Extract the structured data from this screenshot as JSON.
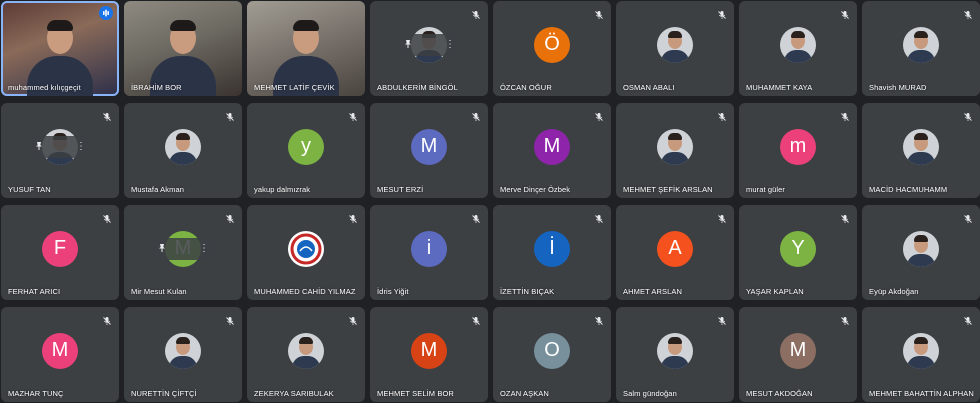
{
  "meeting": {
    "participants": [
      {
        "name": "muhammed kılıçgeçit",
        "type": "video",
        "video": "video-1",
        "speaking": true
      },
      {
        "name": "İBRAHİM BOR",
        "type": "video",
        "video": "video-2"
      },
      {
        "name": "MEHMET LATİF ÇEVİK",
        "type": "video",
        "video": "video-3"
      },
      {
        "name": "ABDULKERİM BİNGÖL",
        "type": "photo-pinmenu",
        "muted": true
      },
      {
        "name": "ÖZCAN OĞUR",
        "type": "letter",
        "letter": "Ö",
        "color": "#e8710a",
        "muted": true
      },
      {
        "name": "OSMAN ABALI",
        "type": "photo",
        "muted": true
      },
      {
        "name": "MUHAMMET KAYA",
        "type": "photo",
        "muted": true
      },
      {
        "name": "Shavish MURAD",
        "type": "photo",
        "muted": true
      },
      {
        "name": "YUSUF TAN",
        "type": "photo-pinmenu",
        "muted": true
      },
      {
        "name": "Mustafa Akman",
        "type": "photo",
        "muted": true
      },
      {
        "name": "yakup dalmızrak",
        "type": "letter",
        "letter": "y",
        "color": "#7cb342",
        "muted": true
      },
      {
        "name": "MESUT ERZİ",
        "type": "letter",
        "letter": "M",
        "color": "#5c6bc0",
        "muted": true
      },
      {
        "name": "Merve Dinçer Özbek",
        "type": "letter",
        "letter": "M",
        "color": "#8e24aa",
        "muted": true
      },
      {
        "name": "MEHMET ŞEFİK ARSLAN",
        "type": "photo",
        "muted": true
      },
      {
        "name": "murat güler",
        "type": "letter",
        "letter": "m",
        "color": "#ec407a",
        "muted": true
      },
      {
        "name": "MACİD HACMUHAMM",
        "type": "photo",
        "muted": true
      },
      {
        "name": "FERHAT ARICI",
        "type": "letter",
        "letter": "F",
        "color": "#ec407a",
        "muted": true
      },
      {
        "name": "Mir Mesut Kulan",
        "type": "letter-pinmenu",
        "letter": "M",
        "color": "#7cb342",
        "muted": true
      },
      {
        "name": "MUHAMMED CAHİD YILMAZ",
        "type": "logo",
        "muted": true
      },
      {
        "name": "İdris Yiğit",
        "type": "letter",
        "letter": "i",
        "color": "#5c6bc0",
        "muted": true
      },
      {
        "name": "İZETTİN BIÇAK",
        "type": "letter",
        "letter": "İ",
        "color": "#1565c0",
        "muted": true
      },
      {
        "name": "AHMET ARSLAN",
        "type": "letter",
        "letter": "A",
        "color": "#f4511e",
        "muted": true
      },
      {
        "name": "YAŞAR KAPLAN",
        "type": "letter",
        "letter": "Y",
        "color": "#7cb342",
        "muted": true
      },
      {
        "name": "Eyüp Akdoğan",
        "type": "photo",
        "muted": true
      },
      {
        "name": "MAZHAR TUNÇ",
        "type": "letter",
        "letter": "M",
        "color": "#ec407a",
        "muted": true
      },
      {
        "name": "NURETTİN ÇİFTÇİ",
        "type": "photo",
        "muted": true
      },
      {
        "name": "ZEKERYA SARIBULAK",
        "type": "photo",
        "muted": true
      },
      {
        "name": "MEHMET SELİM BOR",
        "type": "letter",
        "letter": "M",
        "color": "#d84315",
        "muted": true
      },
      {
        "name": "OZAN AŞKAN",
        "type": "letter",
        "letter": "O",
        "color": "#78909c",
        "muted": true
      },
      {
        "name": "Salm gündoğan",
        "type": "photo",
        "muted": true
      },
      {
        "name": "MESUT AKDOĞAN",
        "type": "letter",
        "letter": "M",
        "color": "#8d6e63",
        "muted": true
      },
      {
        "name": "MEHMET BAHATTİN ALPHAN",
        "type": "photo",
        "muted": true
      }
    ]
  }
}
